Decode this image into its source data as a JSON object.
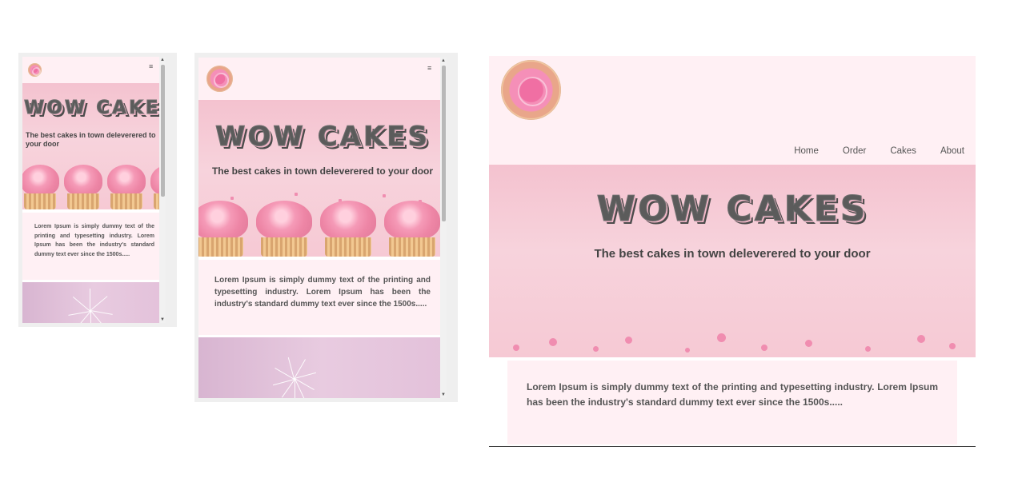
{
  "brand": "WOW CAKES",
  "tagline": "The best cakes in town deleverered to your door",
  "body_text": "Lorem Ipsum is simply dummy text of the printing and typesetting industry. Lorem Ipsum has been the industry's standard dummy text ever since the 1500s.....",
  "menu_icon": "≡",
  "scroll_up": "▲",
  "scroll_down": "▼",
  "nav": {
    "home": "Home",
    "order": "Order",
    "cakes": "Cakes",
    "about": "About"
  },
  "colors": {
    "header_bg": "#fff0f4",
    "hero_pink": "#f6c9d4",
    "text_dark": "#555555"
  },
  "icons": [
    "cupcake-logo-icon",
    "hamburger-menu-icon",
    "sparkler-image",
    "cupcakes-image"
  ]
}
